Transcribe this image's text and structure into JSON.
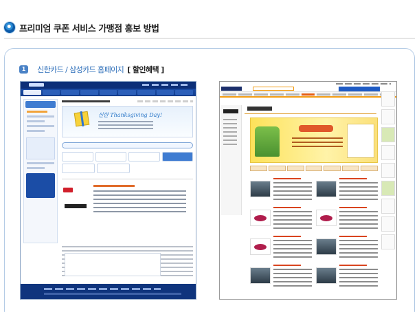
{
  "header": {
    "title": "프리미엄 쿠폰 서비스 가맹점 홍보 방법"
  },
  "section": {
    "number": "1",
    "title": "신한카드 / 삼성카드 홈페이지",
    "bracket": "[ 할인혜택 ]"
  },
  "screenshots": {
    "left": {
      "banner_text": "신한 Thanksgiving Day!"
    },
    "right": {}
  },
  "colors": {
    "accent_blue": "#2a6cb8",
    "frame_border": "#b5cce6",
    "shinhan_navy": "#0c2f78",
    "samsung_orange": "#f39c12"
  }
}
